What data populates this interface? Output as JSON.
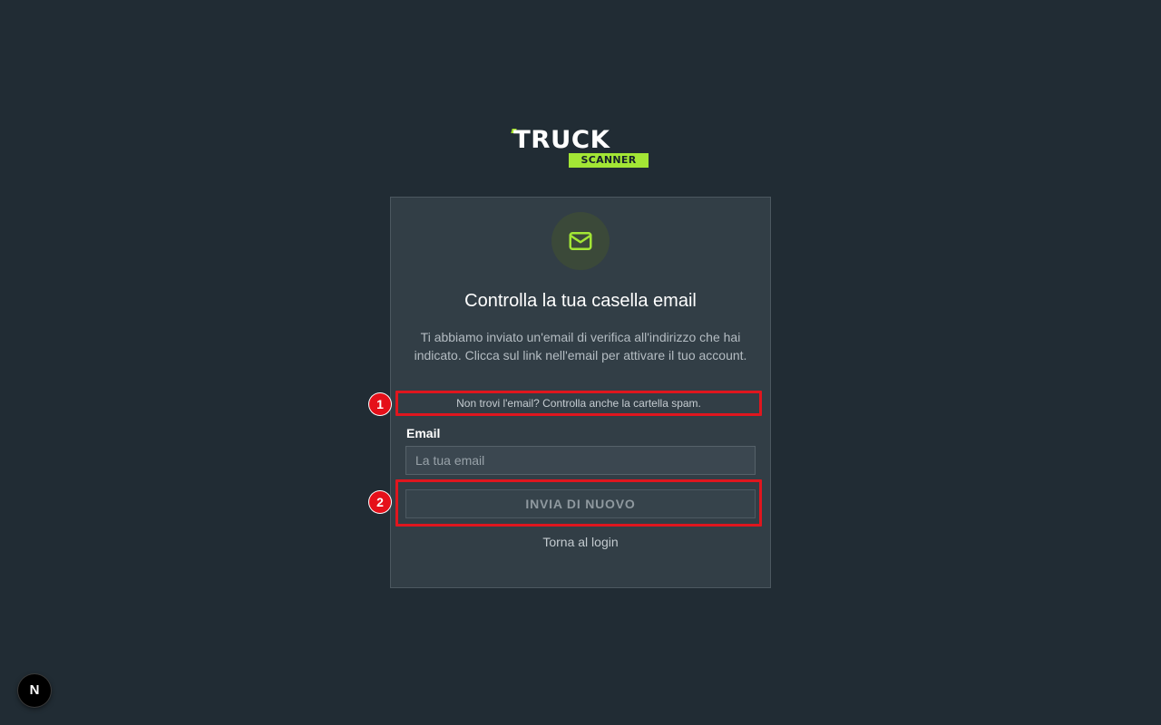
{
  "logo": {
    "word1": "TRUCK",
    "word2": "SCANNER"
  },
  "card": {
    "icon": "mail-icon",
    "title": "Controlla la tua casella email",
    "description": "Ti abbiamo inviato un'email di verifica all'indirizzo che hai indicato. Clicca sul link nell'email per attivare il tuo account.",
    "spam_hint": "Non trovi l'email? Controlla anche la cartella spam.",
    "email_label": "Email",
    "email_placeholder": "La tua email",
    "email_value": "",
    "resend_label": "INVIA DI NUOVO",
    "back_link": "Torna al login"
  },
  "markers": {
    "m1": "1",
    "m2": "2"
  },
  "dev_badge": {
    "label": "N"
  },
  "colors": {
    "background": "#212c34",
    "card": "#323e46",
    "accent": "#a3e635",
    "marker": "#e5101a"
  }
}
